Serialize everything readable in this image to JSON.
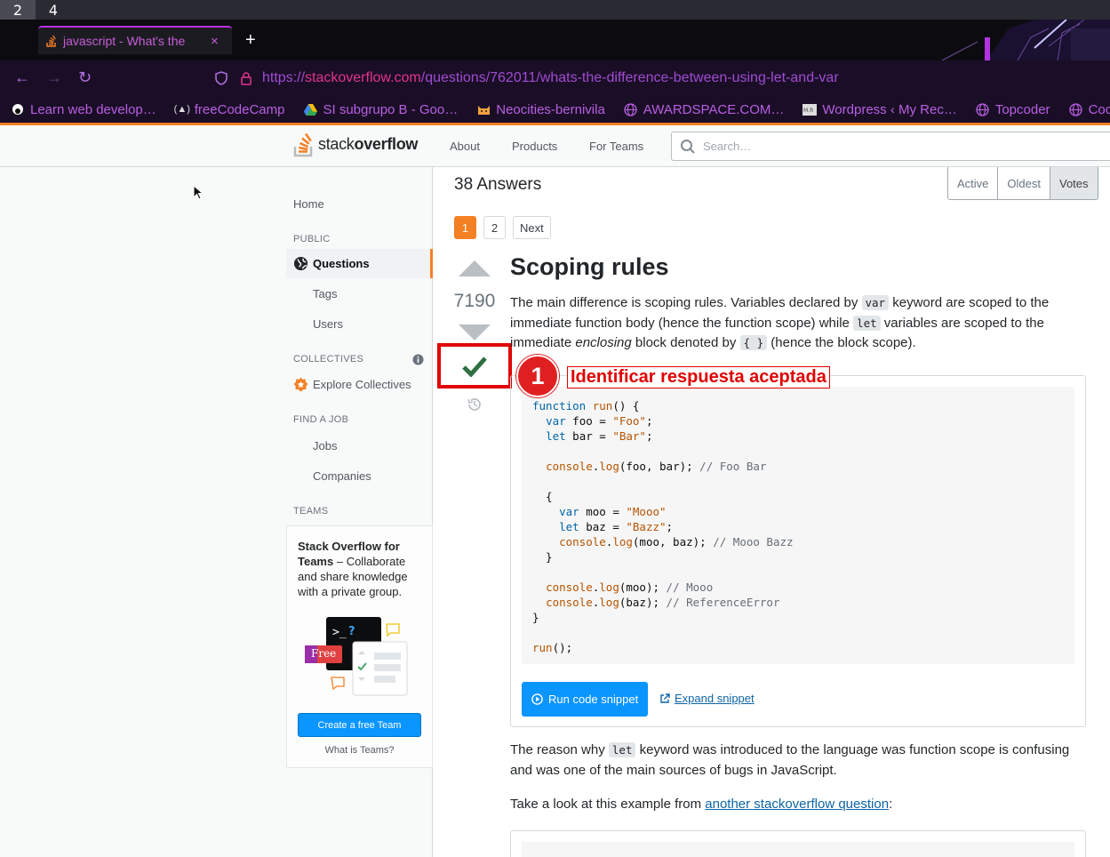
{
  "workspaces": [
    "2",
    "4"
  ],
  "browser": {
    "tab_title": "javascript - What's the",
    "tab_close": "×",
    "new_tab": "+",
    "url_prefix": "https://",
    "url_domain": "stackoverflow.com",
    "url_path": "/questions/762011/whats-the-difference-between-using-let-and-var",
    "bookmarks": [
      "Learn web develop…",
      "freeCodeCamp",
      "SI subgrupo B - Goo…",
      "Neocities-bernivila",
      "AWARDSPACE.COM…",
      "Wordpress ‹ My Rec…",
      "Topcoder",
      "Coc"
    ]
  },
  "header": {
    "logo_light": "stack",
    "logo_bold": "overflow",
    "nav": [
      "About",
      "Products",
      "For Teams"
    ],
    "search_placeholder": "Search…"
  },
  "sidebar": {
    "home": "Home",
    "public_heading": "PUBLIC",
    "questions": "Questions",
    "tags": "Tags",
    "users": "Users",
    "collectives_heading": "COLLECTIVES",
    "explore_collectives": "Explore Collectives",
    "find_job_heading": "FIND A JOB",
    "jobs": "Jobs",
    "companies": "Companies",
    "teams_heading": "TEAMS",
    "teams_title": "Stack Overflow for Teams",
    "teams_desc": " – Collaborate and share knowledge with a private group.",
    "free_badge": "Free",
    "create_team": "Create a free Team",
    "what_is_teams": "What is Teams?"
  },
  "main": {
    "answers_count_title": "38 Answers",
    "sort_options": [
      "Active",
      "Oldest",
      "Votes"
    ],
    "sort_selected": "Votes",
    "pages": [
      "1",
      "2",
      "Next"
    ],
    "current_page": "1",
    "vote_count": "7190",
    "answer_heading": "Scoping rules",
    "p1_a": "The main difference is scoping rules. Variables declared by ",
    "p1_code1": "var",
    "p1_b": " keyword are scoped to the immediate function body (hence the function scope) while ",
    "p1_code2": "let",
    "p1_c": " variables are scoped to the immediate ",
    "p1_em": "enclosing",
    "p1_d": " block denoted by ",
    "p1_code3": "{ }",
    "p1_e": " (hence the block scope).",
    "run_snippet": "Run code snippet",
    "expand_snippet": "Expand snippet",
    "p2_a": "The reason why ",
    "p2_code": "let",
    "p2_b": " keyword was introduced to the language was function scope is confusing and was one of the main sources of bugs in JavaScript.",
    "p3_a": "Take a look at this example from ",
    "p3_link": "another stackoverflow question",
    "p3_b": ":"
  },
  "annotation": {
    "number": "1",
    "label": "Identificar respuesta aceptada"
  },
  "colors": {
    "so_orange": "#f48024",
    "accepted_green": "#2f6f44",
    "annotation_red": "#e00000",
    "primary_blue": "#0a95ff"
  }
}
